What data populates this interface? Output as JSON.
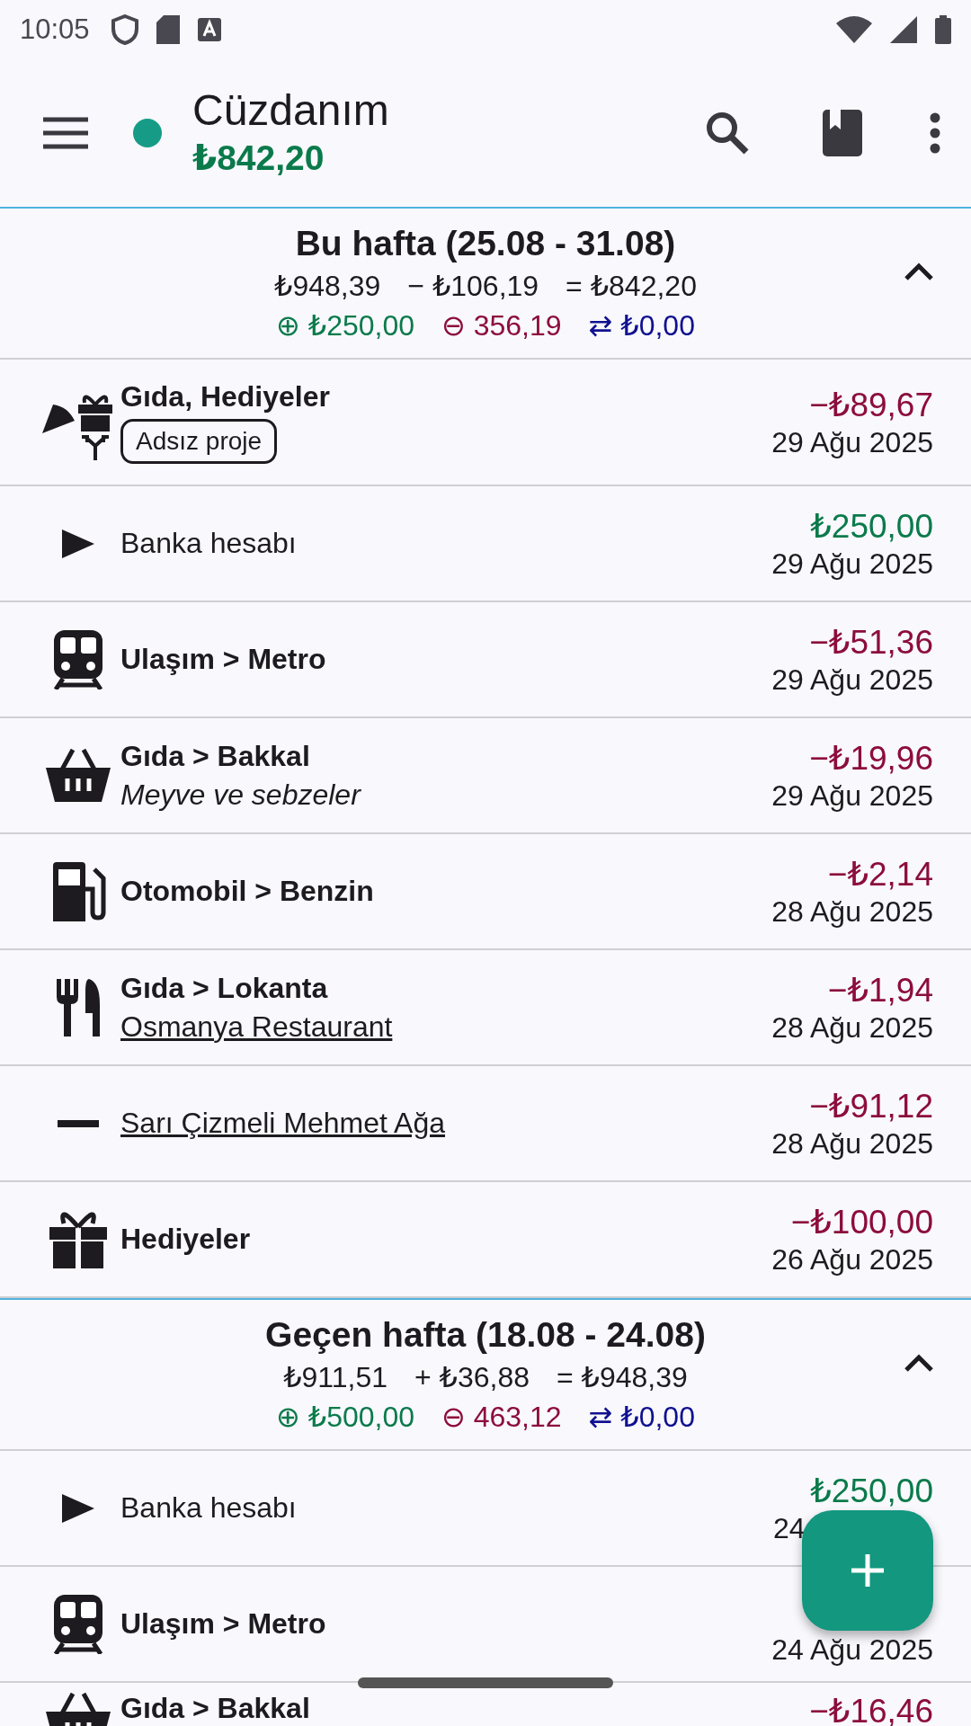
{
  "status_bar": {
    "time": "10:05"
  },
  "app_bar": {
    "title": "Cüzdanım",
    "balance": "₺842,20"
  },
  "sections": [
    {
      "title": "Bu hafta (25.08 - 31.08)",
      "expanded": true,
      "summary": [
        "₺948,39",
        "− ₺106,19",
        "= ₺842,20"
      ],
      "income": "⊕ ₺250,00",
      "expense": "⊖ 356,19",
      "transfer": "⇄ ₺0,00",
      "rows": [
        {
          "kind": "split",
          "title": "Gıda, Hediyeler",
          "tag": "Adsız proje",
          "amount": "−₺89,67",
          "date": "29 Ağu 2025"
        },
        {
          "kind": "transfer",
          "title": "Banka hesabı",
          "amount": "₺250,00",
          "date": "29 Ağu 2025"
        },
        {
          "kind": "train",
          "title": "Ulaşım > Metro",
          "amount": "−₺51,36",
          "date": "29 Ağu 2025"
        },
        {
          "kind": "basket",
          "title": "Gıda > Bakkal",
          "note": "Meyve ve sebzeler",
          "amount": "−₺19,96",
          "date": "29 Ağu 2025"
        },
        {
          "kind": "fuel",
          "title": "Otomobil > Benzin",
          "amount": "−₺2,14",
          "date": "28 Ağu 2025"
        },
        {
          "kind": "cutlery",
          "title": "Gıda > Lokanta",
          "payee": "Osmanya Restaurant",
          "amount": "−₺1,94",
          "date": "28 Ağu 2025"
        },
        {
          "kind": "uncategorized",
          "payee": "Sarı Çizmeli Mehmet Ağa",
          "amount": "−₺91,12",
          "date": "28 Ağu 2025"
        },
        {
          "kind": "gift",
          "title": "Hediyeler",
          "amount": "−₺100,00",
          "date": "26 Ağu 2025"
        }
      ]
    },
    {
      "title": "Geçen hafta (18.08 - 24.08)",
      "expanded": true,
      "summary": [
        "₺911,51",
        "+ ₺36,88",
        "= ₺948,39"
      ],
      "income": "⊕ ₺500,00",
      "expense": "⊖ 463,12",
      "transfer": "⇄ ₺0,00",
      "rows": [
        {
          "kind": "transfer",
          "title": "Banka hesabı",
          "amount": "₺250,00",
          "date": "24"
        },
        {
          "kind": "train",
          "title": "Ulaşım > Metro",
          "date": "24 Ağu 2025"
        },
        {
          "kind": "basket",
          "title": "Gıda > Bakkal",
          "amount": "−₺16,46"
        }
      ]
    }
  ]
}
